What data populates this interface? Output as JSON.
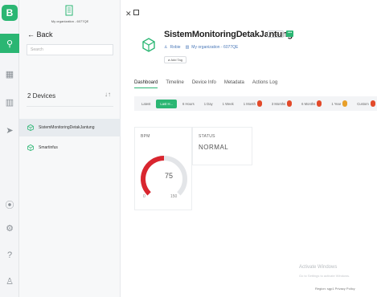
{
  "rail": {
    "logo": "B",
    "colors": {
      "accent": "#2bb673",
      "bg": "#f4f5f7"
    },
    "items": [
      {
        "name": "search-icon",
        "glyph": "⚲",
        "active": true
      },
      {
        "name": "grid-icon",
        "glyph": "▦"
      },
      {
        "name": "building-icon",
        "glyph": "▥"
      },
      {
        "name": "send-icon",
        "glyph": "➤"
      },
      {
        "name": "broadcast-icon",
        "glyph": "⦿"
      },
      {
        "name": "settings-icon",
        "glyph": "⚙"
      },
      {
        "name": "help-icon",
        "glyph": "?"
      },
      {
        "name": "user-icon",
        "glyph": "♙"
      }
    ]
  },
  "panel": {
    "org_name": "My organization - 6077QE",
    "back_label": "← Back",
    "search_placeholder": "Search",
    "devices_title": "2 Devices",
    "sort_icon": "↓↑",
    "devices": [
      {
        "label": "SistemMonitoringDetakJantung",
        "selected": true
      },
      {
        "label": "Smartinfus",
        "selected": false
      }
    ]
  },
  "window": {
    "close": "✕"
  },
  "device": {
    "title": "SistemMonitoringDetakJantung",
    "status_badge": "Offline",
    "more": "•••",
    "owner": "Robie",
    "org": "My organization - 6077QE",
    "add_tag": "Add Tag"
  },
  "tabs": [
    {
      "label": "Dashboard",
      "active": true
    },
    {
      "label": "Timeline"
    },
    {
      "label": "Device Info"
    },
    {
      "label": "Metadata"
    },
    {
      "label": "Actions Log"
    }
  ],
  "time_ranges": [
    {
      "label": "Latest"
    },
    {
      "label": "Last H...",
      "active": true
    },
    {
      "label": "6 Hours"
    },
    {
      "label": "1 Day"
    },
    {
      "label": "1 Week"
    },
    {
      "label": "1 Month",
      "dot": "#e24a2a"
    },
    {
      "label": "3 Months",
      "dot": "#e24a2a"
    },
    {
      "label": "6 Months",
      "dot": "#e24a2a"
    },
    {
      "label": "1 Year",
      "dot": "#e24a2a"
    },
    {
      "label": "Custom",
      "dot": "#e24a2a"
    }
  ],
  "widgets": {
    "bpm": {
      "title": "BPM",
      "value": "75",
      "min": "0",
      "max": "150",
      "fraction": 0.5,
      "colors": {
        "fill": "#d9262f",
        "track": "#e3e5e8"
      }
    },
    "status": {
      "title": "STATUS",
      "value": "NORMAL"
    }
  },
  "watermark": {
    "line1": "Activate Windows",
    "line2": "Go to Settings to activate Windows."
  },
  "footer": "Region: sgp1 Privacy Policy"
}
